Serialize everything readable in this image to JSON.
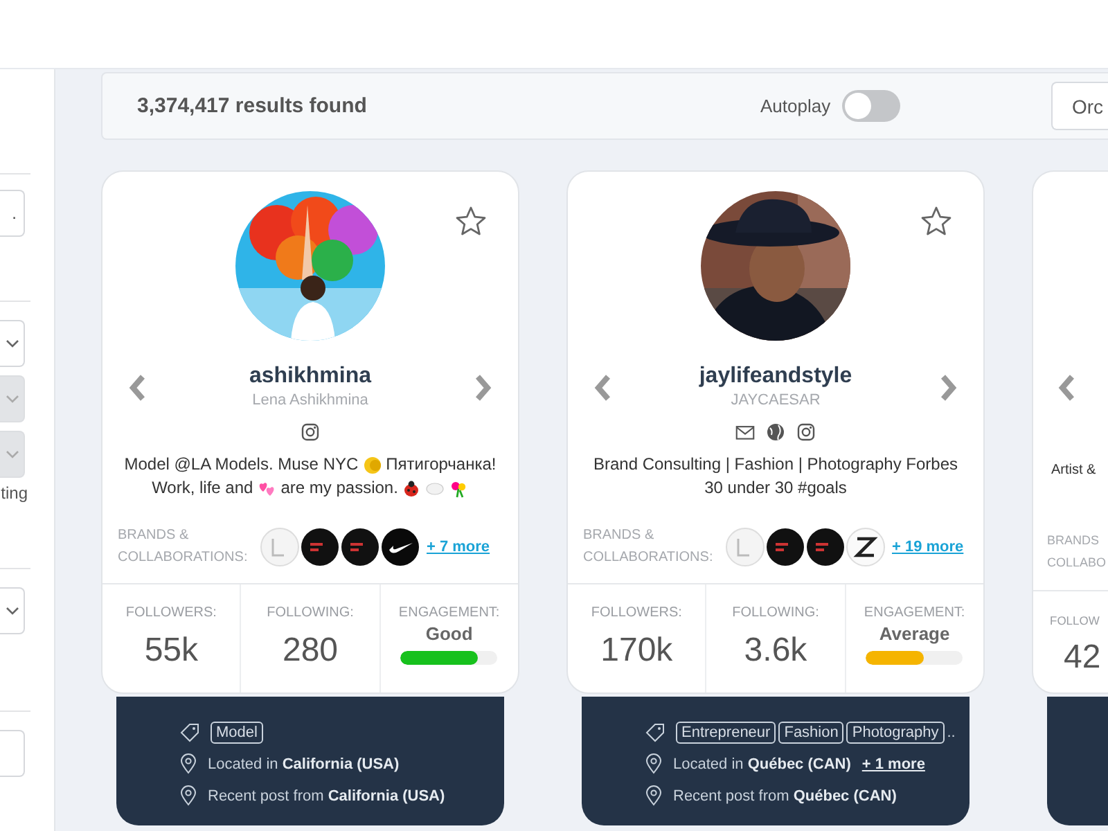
{
  "sidebar": {
    "controls": [
      {
        "kind": "divider"
      },
      {
        "kind": "field",
        "value": "."
      },
      {
        "kind": "divider"
      },
      {
        "kind": "dropdown",
        "disabled": false
      },
      {
        "kind": "dropdown",
        "disabled": true
      },
      {
        "kind": "dropdown",
        "disabled": true
      },
      {
        "kind": "text",
        "text": "ting"
      },
      {
        "kind": "divider"
      },
      {
        "kind": "dropdown",
        "disabled": false
      },
      {
        "kind": "divider"
      },
      {
        "kind": "field"
      }
    ]
  },
  "results_bar": {
    "count": "3,374,417 results found",
    "autoplay": {
      "label": "Autoplay",
      "on": false
    },
    "order_button": "Orc"
  },
  "cards": [
    {
      "username": "ashikhmina",
      "full_name": "Lena Ashikhmina",
      "social": [
        {
          "kind": "instagram"
        }
      ],
      "bio_lines": [
        [
          {
            "kind": "text",
            "text": "Model @LA Models. Muse NYC"
          },
          {
            "kind": "moon"
          },
          {
            "kind": "text",
            "text": "Пятигорчанка!"
          }
        ],
        [
          {
            "kind": "text",
            "text": "Work, life and"
          },
          {
            "kind": "hearts"
          },
          {
            "kind": "text",
            "text": "are my passion."
          },
          {
            "kind": "ladybug"
          },
          {
            "kind": "cloud"
          },
          {
            "kind": "flowers"
          }
        ]
      ],
      "brands_label": "BRANDS & COLLABORATIONS:",
      "brand_logos": [
        {
          "kind": "light"
        },
        {
          "kind": "dark"
        },
        {
          "kind": "dark"
        },
        {
          "kind": "swoosh"
        }
      ],
      "brands_more": "+ 7 more",
      "stats": [
        {
          "label": "FOLLOWERS:",
          "value": "55k"
        },
        {
          "label": "FOLLOWING:",
          "value": "280"
        }
      ],
      "engagement": {
        "label": "ENGAGEMENT:",
        "rating": "Good",
        "level": 0.8,
        "color": "#17c11d"
      },
      "tags": [
        "Model"
      ],
      "location": {
        "prefix": "Located in",
        "place": "California (USA)"
      },
      "recent_post": {
        "prefix": "Recent post from",
        "place": "California (USA)"
      }
    },
    {
      "username": "jaylifeandstyle",
      "full_name": "JAYCAESAR",
      "social": [
        {
          "kind": "email"
        },
        {
          "kind": "globe"
        },
        {
          "kind": "instagram"
        }
      ],
      "bio_lines": [
        [
          {
            "kind": "text",
            "text": "Brand Consulting | Fashion | Photography Forbes"
          }
        ],
        [
          {
            "kind": "text",
            "text": "30 under 30 #goals"
          }
        ]
      ],
      "brands_label": "BRANDS & COLLABORATIONS:",
      "brand_logos": [
        {
          "kind": "light"
        },
        {
          "kind": "dark"
        },
        {
          "kind": "dark"
        },
        {
          "kind": "letter"
        }
      ],
      "brands_more": "+ 19 more",
      "stats": [
        {
          "label": "FOLLOWERS:",
          "value": "170k"
        },
        {
          "label": "FOLLOWING:",
          "value": "3.6k"
        }
      ],
      "engagement": {
        "label": "ENGAGEMENT:",
        "rating": "Average",
        "level": 0.6,
        "color": "#f5b400"
      },
      "tags": [
        "Entrepreneur",
        "Fashion",
        "Photography"
      ],
      "tags_more": "..",
      "location": {
        "prefix": "Located in",
        "place": "Québec (CAN)",
        "more": "+ 1 more"
      },
      "recent_post": {
        "prefix": "Recent post from",
        "place": "Québec (CAN)"
      }
    }
  ],
  "card_peek": {
    "bio": "Artist &",
    "brands_label": [
      "BRANDS",
      "COLLABO"
    ],
    "stat_label": "FOLLOW",
    "stat_value": "42"
  }
}
